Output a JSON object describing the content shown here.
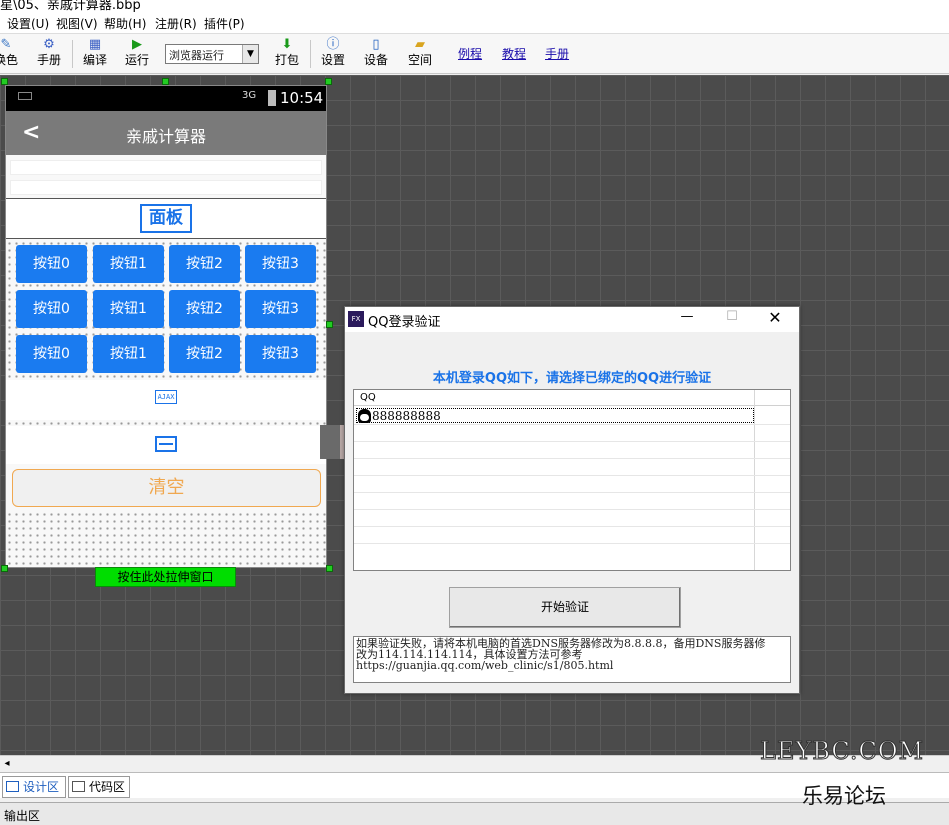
{
  "window": {
    "title": "星\\05、亲戚计算器.bbp"
  },
  "menu": [
    "设置(U)",
    "视图(V)",
    "帮助(H)",
    "注册(R)",
    "插件(P)"
  ],
  "toolbar": {
    "buttons": [
      {
        "label": "换色",
        "icon": "color-icon"
      },
      {
        "label": "手册",
        "icon": "manual-icon"
      },
      {
        "label": "编译",
        "icon": "compile-icon"
      },
      {
        "label": "运行",
        "icon": "run-icon"
      },
      {
        "label": "打包",
        "icon": "package-icon"
      },
      {
        "label": "设置",
        "icon": "info-icon"
      },
      {
        "label": "设备",
        "icon": "device-icon"
      },
      {
        "label": "空间",
        "icon": "folder-icon"
      }
    ],
    "run_mode": "浏览器运行",
    "links": [
      "例程",
      "教程",
      "手册"
    ]
  },
  "phone": {
    "time": "10:54",
    "signal": "3G",
    "title": "亲戚计算器",
    "panel_label": "面板",
    "buttons": [
      [
        "按钮0",
        "按钮1",
        "按钮2",
        "按钮3"
      ],
      [
        "按钮0",
        "按钮1",
        "按钮2",
        "按钮3"
      ],
      [
        "按钮0",
        "按钮1",
        "按钮2",
        "按钮3"
      ]
    ],
    "ajax_label": "AJAX",
    "clear_label": "清空",
    "resize_hint": "按住此处拉伸窗口"
  },
  "dialog": {
    "title": "QQ登录验证",
    "header": "本机登录QQ如下，请选择已绑定的QQ进行验证",
    "column": "QQ",
    "accounts": [
      "888888888"
    ],
    "start_button": "开始验证",
    "note_line1": "如果验证失败，请将本机电脑的首选DNS服务器修改为8.8.8.8，备用DNS服务器修",
    "note_line2": "改为114.114.114.114，具体设置方法可参考",
    "note_line3": "https://guanjia.qq.com/web_clinic/s1/805.html"
  },
  "tabs": [
    "设计区",
    "代码区"
  ],
  "output_label": "输出区",
  "watermark": {
    "domain": "LEYBC.COM",
    "name": "乐易论坛"
  }
}
